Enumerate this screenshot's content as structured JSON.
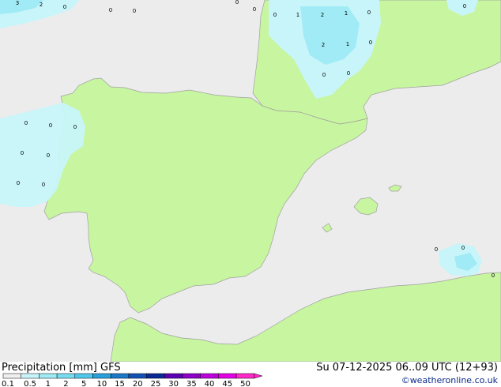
{
  "header": {
    "title": "Precipitation [mm] GFS",
    "valid_time": "Su 07-12-2025 06..09 UTC (12+93)",
    "credit": "©weatheronline.co.uk"
  },
  "legend": {
    "labels": [
      "0.1",
      "0.5",
      "1",
      "2",
      "5",
      "10",
      "15",
      "20",
      "25",
      "30",
      "35",
      "40",
      "45",
      "50"
    ],
    "colors": [
      "#f0f0f0",
      "#c8f5fa",
      "#a0ebf5",
      "#78dcf0",
      "#50c8eb",
      "#28a0dc",
      "#1e78c8",
      "#1450b4",
      "#0a2896",
      "#5a00b4",
      "#8c00c8",
      "#be00dc",
      "#e600e6",
      "#ff28c8"
    ]
  },
  "colors": {
    "sea": "#ececec",
    "land": "#c8f5a0",
    "precip_light": "#c8f5fa",
    "precip_medium": "#a0ebf5",
    "precip_heavy": "#78dcf0",
    "border": "#a0a0a0"
  },
  "map_labels": [
    "3",
    "2",
    "0",
    "0",
    "0",
    "0",
    "1",
    "2",
    "1",
    "0",
    "2",
    "1",
    "0",
    "0",
    "0",
    "0",
    "0",
    "0",
    "0",
    "0",
    "0",
    "0",
    "0",
    "0",
    "0",
    "0",
    "0",
    "0"
  ]
}
